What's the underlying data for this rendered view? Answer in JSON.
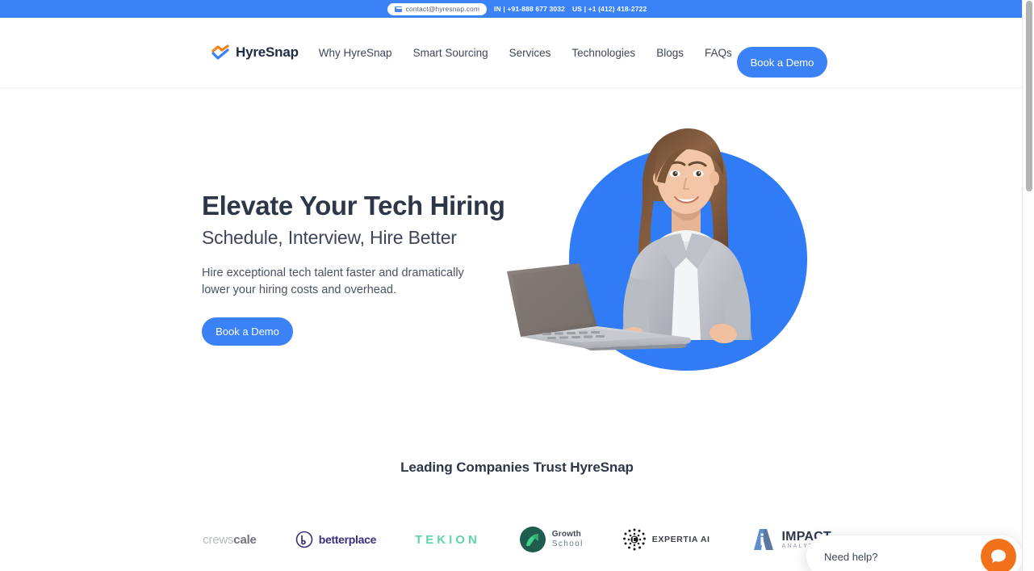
{
  "topbar": {
    "email_icon": "mail-icon",
    "email": "contact@hyresnap.com",
    "phone_in": "IN | +91-888 677 3032",
    "phone_us": "US | +1 (412) 418-2722"
  },
  "header": {
    "brand_name": "HyreSnap",
    "brand_icon": "hyresnap-logo-icon",
    "nav": [
      {
        "label": "Why HyreSnap"
      },
      {
        "label": "Smart Sourcing"
      },
      {
        "label": "Services"
      },
      {
        "label": "Technologies"
      },
      {
        "label": "Blogs"
      },
      {
        "label": "FAQs"
      }
    ],
    "cta_label": "Book a Demo"
  },
  "hero": {
    "title": "Elevate Your Tech Hiring",
    "subtitle": "Schedule, Interview, Hire Better",
    "description": "Hire exceptional tech talent faster and dramatically lower your hiring costs and overhead.",
    "cta_label": "Book a Demo",
    "image_alt": "businesswoman-holding-laptop"
  },
  "trust": {
    "heading": "Leading Companies Trust HyreSnap",
    "logos": [
      {
        "name": "crewscale",
        "text_light": "crews",
        "text_bold": "cale"
      },
      {
        "name": "betterplace",
        "text": "betterplace"
      },
      {
        "name": "tekion",
        "text": "TEKION"
      },
      {
        "name": "growth-school",
        "line1": "Growth",
        "line2": "School"
      },
      {
        "name": "expertia-ai",
        "text": "EXPERTIA AI"
      },
      {
        "name": "impact-analytics",
        "line1": "IMPACT",
        "line2": "ANALYTICS"
      }
    ]
  },
  "chat": {
    "label": "Need help?",
    "fab_icon": "chat-bubble-icon"
  },
  "colors": {
    "brand_blue": "#3b82f6",
    "brand_orange": "#f2721c",
    "text_dark": "#2d3748"
  }
}
